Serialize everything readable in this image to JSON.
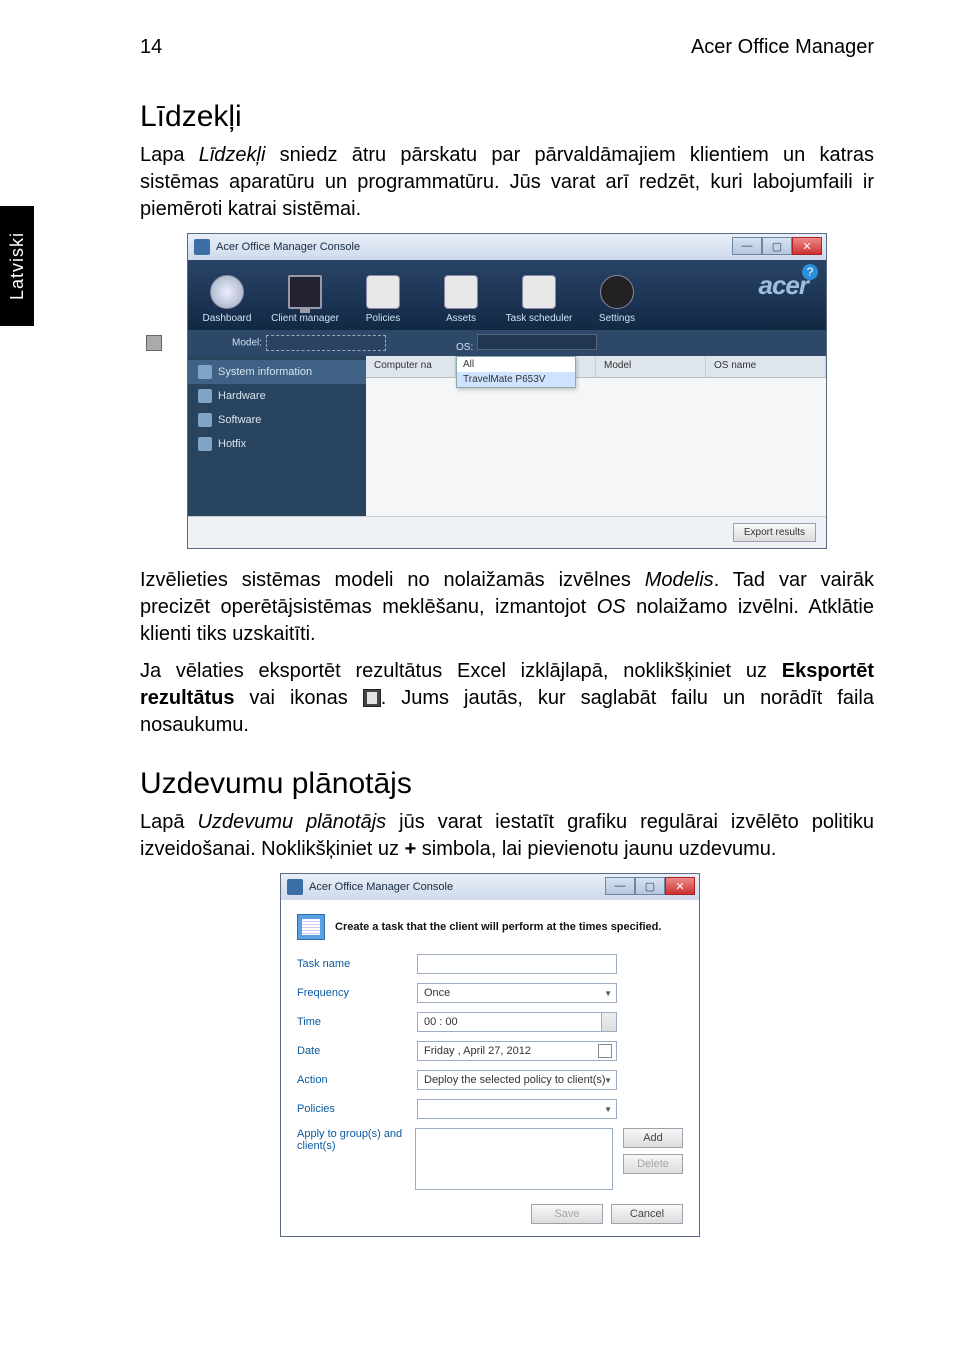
{
  "page_number": "14",
  "header_right": "Acer Office Manager",
  "side_tab": "Latviski",
  "section1": {
    "title": "Līdzekļi",
    "p1a": "Lapa ",
    "p1_em": "Līdzekļi",
    "p1b": " sniedz ātru pārskatu par pārvaldāmajiem klientiem un katras sistēmas aparatūru un programmatūru. Jūs varat arī redzēt, kuri labojumfaili ir piemēroti katrai sistēmai.",
    "p2a": "Izvēlieties sistēmas modeli no nolaižamās izvēlnes ",
    "p2_em1": "Modelis",
    "p2b": ". Tad var vairāk precizēt operētājsistēmas meklēšanu, izmantojot ",
    "p2_em2": "OS",
    "p2c": " nolaižamo izvēlni. Atklātie klienti tiks uzskaitīti.",
    "p3a": "Ja vēlaties eksportēt rezultātus Excel izklājlapā, noklikšķiniet uz ",
    "p3_bold": "Eksportēt rezultātus",
    "p3b": " vai ikonas ",
    "p3c": ". Jums jautās, kur saglabāt failu un norādīt faila nosaukumu."
  },
  "shot1": {
    "title": "Acer Office Manager Console",
    "min": "—",
    "max": "▢",
    "close": "✕",
    "brand": "acer",
    "help": "?",
    "nav": {
      "dashboard": "Dashboard",
      "client": "Client manager",
      "policies": "Policies",
      "assets": "Assets",
      "scheduler": "Task scheduler",
      "settings": "Settings"
    },
    "toolbar": {
      "model_label": "Model:",
      "os_label": "OS:"
    },
    "side": {
      "sysinfo": "System information",
      "hardware": "Hardware",
      "software": "Software",
      "hotfix": "Hotfix"
    },
    "table": {
      "headers": {
        "c1": "Computer na",
        "c2": "",
        "c3": "Model",
        "c4": "OS name"
      },
      "dropdown": {
        "opt1": "All",
        "opt2": "TravelMate P653V"
      }
    },
    "export_btn": "Export results"
  },
  "section2": {
    "title": "Uzdevumu plānotājs",
    "p1a": "Lapā ",
    "p1_em": "Uzdevumu plānotājs",
    "p1b": " jūs varat iestatīt grafiku regulārai izvēlēto politiku izveidošanai. Noklikšķiniet uz ",
    "p1_bold": "+",
    "p1c": " simbola, lai pievienotu jaunu uzdevumu."
  },
  "shot2": {
    "title": "Acer Office Manager Console",
    "heading": "Create a task that the client will perform at the times specified.",
    "labels": {
      "taskname": "Task name",
      "frequency": "Frequency",
      "time": "Time",
      "date": "Date",
      "action": "Action",
      "policies": "Policies",
      "apply": "Apply to group(s) and client(s)"
    },
    "values": {
      "frequency": "Once",
      "time": "00 : 00",
      "date": "Friday   ,   April    27, 2012",
      "action": "Deploy the selected policy to client(s)"
    },
    "buttons": {
      "add": "Add",
      "delete": "Delete",
      "save": "Save",
      "cancel": "Cancel"
    }
  }
}
